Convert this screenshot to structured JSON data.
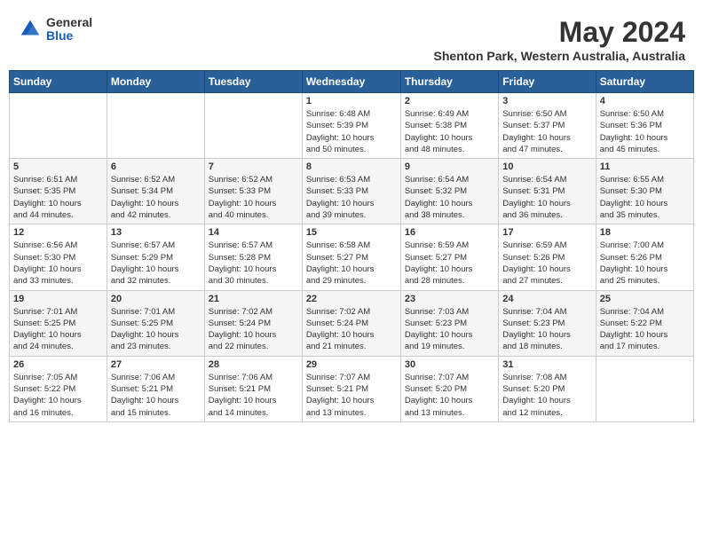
{
  "header": {
    "logo_general": "General",
    "logo_blue": "Blue",
    "month_title": "May 2024",
    "location": "Shenton Park, Western Australia, Australia"
  },
  "days_of_week": [
    "Sunday",
    "Monday",
    "Tuesday",
    "Wednesday",
    "Thursday",
    "Friday",
    "Saturday"
  ],
  "weeks": [
    [
      {
        "day": "",
        "info": ""
      },
      {
        "day": "",
        "info": ""
      },
      {
        "day": "",
        "info": ""
      },
      {
        "day": "1",
        "info": "Sunrise: 6:48 AM\nSunset: 5:39 PM\nDaylight: 10 hours\nand 50 minutes."
      },
      {
        "day": "2",
        "info": "Sunrise: 6:49 AM\nSunset: 5:38 PM\nDaylight: 10 hours\nand 48 minutes."
      },
      {
        "day": "3",
        "info": "Sunrise: 6:50 AM\nSunset: 5:37 PM\nDaylight: 10 hours\nand 47 minutes."
      },
      {
        "day": "4",
        "info": "Sunrise: 6:50 AM\nSunset: 5:36 PM\nDaylight: 10 hours\nand 45 minutes."
      }
    ],
    [
      {
        "day": "5",
        "info": "Sunrise: 6:51 AM\nSunset: 5:35 PM\nDaylight: 10 hours\nand 44 minutes."
      },
      {
        "day": "6",
        "info": "Sunrise: 6:52 AM\nSunset: 5:34 PM\nDaylight: 10 hours\nand 42 minutes."
      },
      {
        "day": "7",
        "info": "Sunrise: 6:52 AM\nSunset: 5:33 PM\nDaylight: 10 hours\nand 40 minutes."
      },
      {
        "day": "8",
        "info": "Sunrise: 6:53 AM\nSunset: 5:33 PM\nDaylight: 10 hours\nand 39 minutes."
      },
      {
        "day": "9",
        "info": "Sunrise: 6:54 AM\nSunset: 5:32 PM\nDaylight: 10 hours\nand 38 minutes."
      },
      {
        "day": "10",
        "info": "Sunrise: 6:54 AM\nSunset: 5:31 PM\nDaylight: 10 hours\nand 36 minutes."
      },
      {
        "day": "11",
        "info": "Sunrise: 6:55 AM\nSunset: 5:30 PM\nDaylight: 10 hours\nand 35 minutes."
      }
    ],
    [
      {
        "day": "12",
        "info": "Sunrise: 6:56 AM\nSunset: 5:30 PM\nDaylight: 10 hours\nand 33 minutes."
      },
      {
        "day": "13",
        "info": "Sunrise: 6:57 AM\nSunset: 5:29 PM\nDaylight: 10 hours\nand 32 minutes."
      },
      {
        "day": "14",
        "info": "Sunrise: 6:57 AM\nSunset: 5:28 PM\nDaylight: 10 hours\nand 30 minutes."
      },
      {
        "day": "15",
        "info": "Sunrise: 6:58 AM\nSunset: 5:27 PM\nDaylight: 10 hours\nand 29 minutes."
      },
      {
        "day": "16",
        "info": "Sunrise: 6:59 AM\nSunset: 5:27 PM\nDaylight: 10 hours\nand 28 minutes."
      },
      {
        "day": "17",
        "info": "Sunrise: 6:59 AM\nSunset: 5:26 PM\nDaylight: 10 hours\nand 27 minutes."
      },
      {
        "day": "18",
        "info": "Sunrise: 7:00 AM\nSunset: 5:26 PM\nDaylight: 10 hours\nand 25 minutes."
      }
    ],
    [
      {
        "day": "19",
        "info": "Sunrise: 7:01 AM\nSunset: 5:25 PM\nDaylight: 10 hours\nand 24 minutes."
      },
      {
        "day": "20",
        "info": "Sunrise: 7:01 AM\nSunset: 5:25 PM\nDaylight: 10 hours\nand 23 minutes."
      },
      {
        "day": "21",
        "info": "Sunrise: 7:02 AM\nSunset: 5:24 PM\nDaylight: 10 hours\nand 22 minutes."
      },
      {
        "day": "22",
        "info": "Sunrise: 7:02 AM\nSunset: 5:24 PM\nDaylight: 10 hours\nand 21 minutes."
      },
      {
        "day": "23",
        "info": "Sunrise: 7:03 AM\nSunset: 5:23 PM\nDaylight: 10 hours\nand 19 minutes."
      },
      {
        "day": "24",
        "info": "Sunrise: 7:04 AM\nSunset: 5:23 PM\nDaylight: 10 hours\nand 18 minutes."
      },
      {
        "day": "25",
        "info": "Sunrise: 7:04 AM\nSunset: 5:22 PM\nDaylight: 10 hours\nand 17 minutes."
      }
    ],
    [
      {
        "day": "26",
        "info": "Sunrise: 7:05 AM\nSunset: 5:22 PM\nDaylight: 10 hours\nand 16 minutes."
      },
      {
        "day": "27",
        "info": "Sunrise: 7:06 AM\nSunset: 5:21 PM\nDaylight: 10 hours\nand 15 minutes."
      },
      {
        "day": "28",
        "info": "Sunrise: 7:06 AM\nSunset: 5:21 PM\nDaylight: 10 hours\nand 14 minutes."
      },
      {
        "day": "29",
        "info": "Sunrise: 7:07 AM\nSunset: 5:21 PM\nDaylight: 10 hours\nand 13 minutes."
      },
      {
        "day": "30",
        "info": "Sunrise: 7:07 AM\nSunset: 5:20 PM\nDaylight: 10 hours\nand 13 minutes."
      },
      {
        "day": "31",
        "info": "Sunrise: 7:08 AM\nSunset: 5:20 PM\nDaylight: 10 hours\nand 12 minutes."
      },
      {
        "day": "",
        "info": ""
      }
    ]
  ]
}
